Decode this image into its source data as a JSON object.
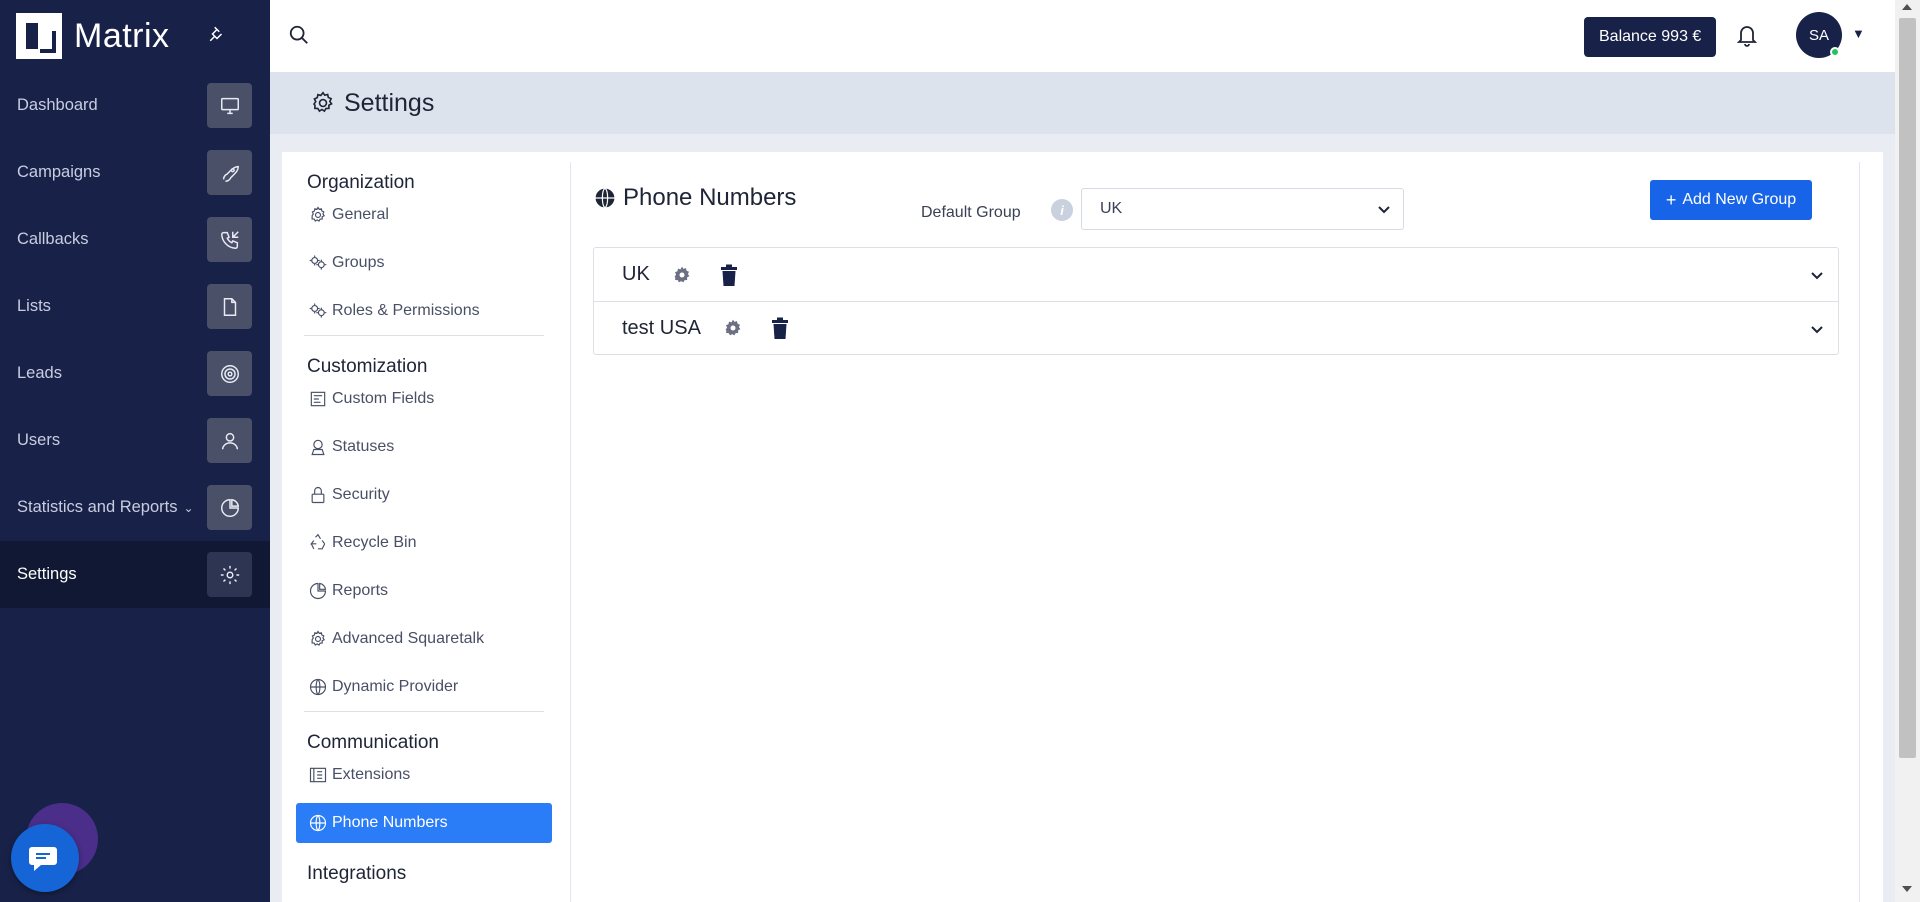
{
  "app": {
    "name": "Matrix"
  },
  "sidebar": {
    "items": [
      {
        "label": "Dashboard",
        "icon": "monitor-icon"
      },
      {
        "label": "Campaigns",
        "icon": "rocket-icon"
      },
      {
        "label": "Callbacks",
        "icon": "phone-callback-icon"
      },
      {
        "label": "Lists",
        "icon": "document-icon"
      },
      {
        "label": "Leads",
        "icon": "target-icon"
      },
      {
        "label": "Users",
        "icon": "user-icon"
      },
      {
        "label": "Statistics and Reports",
        "icon": "pie-chart-icon"
      },
      {
        "label": "Settings",
        "icon": "gear-icon"
      }
    ]
  },
  "topbar": {
    "balance": "Balance 993 €",
    "avatar_initials": "SA"
  },
  "page": {
    "title": "Settings"
  },
  "settings_nav": {
    "organization": {
      "title": "Organization",
      "items": [
        "General",
        "Groups",
        "Roles & Permissions"
      ]
    },
    "customization": {
      "title": "Customization",
      "items": [
        "Custom Fields",
        "Statuses",
        "Security",
        "Recycle Bin",
        "Reports",
        "Advanced Squaretalk",
        "Dynamic Provider"
      ]
    },
    "communication": {
      "title": "Communication",
      "items": [
        "Extensions",
        "Phone Numbers"
      ]
    },
    "integrations": {
      "title": "Integrations"
    }
  },
  "phone_numbers": {
    "title": "Phone Numbers",
    "default_group_label": "Default Group",
    "default_group_value": "UK",
    "add_button": "Add New Group",
    "groups": [
      "UK",
      "test USA"
    ]
  },
  "colors": {
    "sidebar_bg": "#182148",
    "accent": "#1764e8",
    "active_nav": "#2b7cf7"
  }
}
